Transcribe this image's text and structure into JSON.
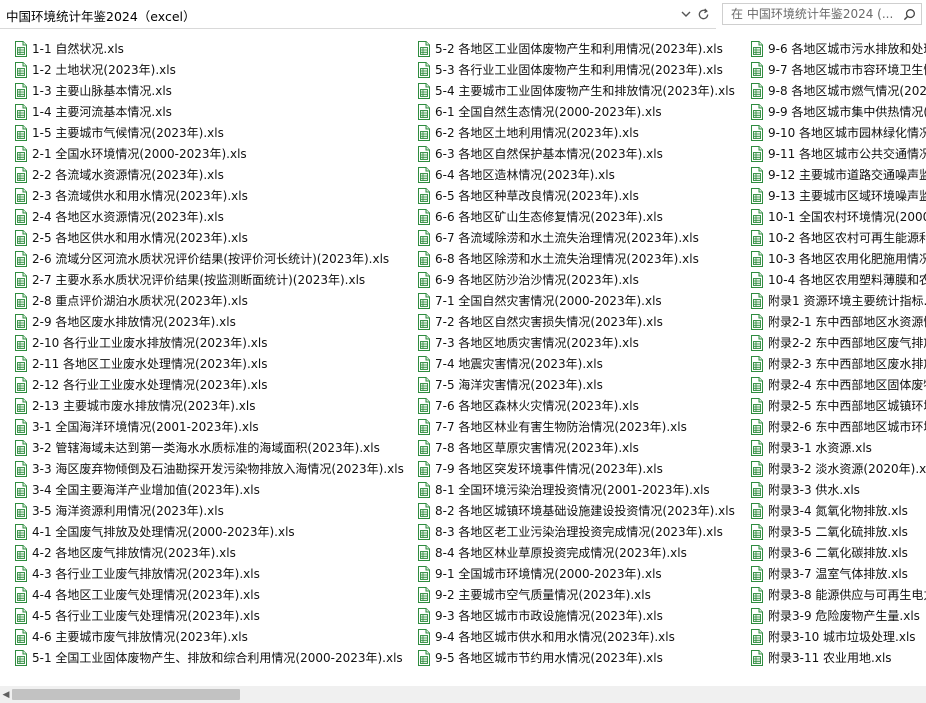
{
  "address_bar": {
    "path": "中国环境统计年鉴2024（excel）"
  },
  "search": {
    "placeholder": "在 中国环境统计年鉴2024 (... "
  },
  "columns": [
    [
      "1-1 自然状况.xls",
      "1-2 土地状况(2023年).xls",
      "1-3 主要山脉基本情况.xls",
      "1-4 主要河流基本情况.xls",
      "1-5 主要城市气候情况(2023年).xls",
      "2-1 全国水环境情况(2000-2023年).xls",
      "2-2 各流域水资源情况(2023年).xls",
      "2-3 各流域供水和用水情况(2023年).xls",
      "2-4 各地区水资源情况(2023年).xls",
      "2-5 各地区供水和用水情况(2023年).xls",
      "2-6 流域分区河流水质状况评价结果(按评价河长统计)(2023年).xls",
      "2-7 主要水系水质状况评价结果(按监测断面统计)(2023年).xls",
      "2-8 重点评价湖泊水质状况(2023年).xls",
      "2-9 各地区废水排放情况(2023年).xls",
      "2-10 各行业工业废水排放情况(2023年).xls",
      "2-11 各地区工业废水处理情况(2023年).xls",
      "2-12 各行业工业废水处理情况(2023年).xls",
      "2-13 主要城市废水排放情况(2023年).xls",
      "3-1 全国海洋环境情况(2001-2023年).xls",
      "3-2 管辖海域未达到第一类海水水质标准的海域面积(2023年).xls",
      "3-3 海区废弃物倾倒及石油勘探开发污染物排放入海情况(2023年).xls",
      "3-4 全国主要海洋产业增加值(2023年).xls",
      "3-5 海洋资源利用情况(2023年).xls",
      "4-1 全国废气排放及处理情况(2000-2023年).xls",
      "4-2 各地区废气排放情况(2023年).xls",
      "4-3 各行业工业废气排放情况(2023年).xls",
      "4-4 各地区工业废气处理情况(2023年).xls",
      "4-5 各行业工业废气处理情况(2023年).xls",
      "4-6 主要城市废气排放情况(2023年).xls",
      "5-1 全国工业固体废物产生、排放和综合利用情况(2000-2023年).xls"
    ],
    [
      "5-2 各地区工业固体废物产生和利用情况(2023年).xls",
      "5-3 各行业工业固体废物产生和利用情况(2023年).xls",
      "5-4 主要城市工业固体废物产生和排放情况(2023年).xls",
      "6-1 全国自然生态情况(2000-2023年).xls",
      "6-2 各地区土地利用情况(2023年).xls",
      "6-3 各地区自然保护基本情况(2023年).xls",
      "6-4 各地区造林情况(2023年).xls",
      "6-5 各地区种草改良情况(2023年).xls",
      "6-6 各地区矿山生态修复情况(2023年).xls",
      "6-7 各流域除涝和水土流失治理情况(2023年).xls",
      "6-8 各地区除涝和水土流失治理情况(2023年).xls",
      "6-9 各地区防沙治沙情况(2023年).xls",
      "7-1 全国自然灾害情况(2000-2023年).xls",
      "7-2 各地区自然灾害损失情况(2023年).xls",
      "7-3 各地区地质灾害情况(2023年).xls",
      "7-4 地震灾害情况(2023年).xls",
      "7-5 海洋灾害情况(2023年).xls",
      "7-6 各地区森林火灾情况(2023年).xls",
      "7-7 各地区林业有害生物防治情况(2023年).xls",
      "7-8 各地区草原灾害情况(2023年).xls",
      "7-9 各地区突发环境事件情况(2023年).xls",
      "8-1 全国环境污染治理投资情况(2001-2023年).xls",
      "8-2 各地区城镇环境基础设施建设投资情况(2023年).xls",
      "8-3 各地区老工业污染治理投资完成情况(2023年).xls",
      "8-4 各地区林业草原投资完成情况(2023年).xls",
      "9-1 全国城市环境情况(2000-2023年).xls",
      "9-2 主要城市空气质量情况(2023年).xls",
      "9-3 各地区城市市政设施情况(2023年).xls",
      "9-4 各地区城市供水和用水情况(2023年).xls",
      "9-5 各地区城市节约用水情况(2023年).xls"
    ],
    [
      "9-6 各地区城市污水排放和处理",
      "9-7 各地区城市市容环境卫生情",
      "9-8 各地区城市燃气情况(2023",
      "9-9 各地区城市集中供热情况(",
      "9-10 各地区城市园林绿化情况",
      "9-11 各地区城市公共交通情况",
      "9-12 主要城市道路交通噪声监",
      "9-13 主要城市区域环境噪声监",
      "10-1 全国农村环境情况(2000-",
      "10-2 各地区农村可再生能源利",
      "10-3 各地区农用化肥施用情况",
      "10-4 各地区农用塑料薄膜和农",
      "附录1 资源环境主要统计指标.x",
      "附录2-1 东中西部地区水资源情",
      "附录2-2 东中西部地区废气排放",
      "附录2-3 东中西部地区废水排放",
      "附录2-4 东中西部地区固体废物",
      "附录2-5 东中西部地区城镇环境",
      "附录2-6 东中西部地区城市环境",
      "附录3-1 水资源.xls",
      "附录3-2 淡水资源(2020年).xls",
      "附录3-3 供水.xls",
      "附录3-4 氮氧化物排放.xls",
      "附录3-5 二氧化硫排放.xls",
      "附录3-6 二氧化碳排放.xls",
      "附录3-7 温室气体排放.xls",
      "附录3-8 能源供应与可再生电力",
      "附录3-9 危险废物产生量.xls",
      "附录3-10 城市垃圾处理.xls",
      "附录3-11 农业用地.xls"
    ]
  ],
  "icons": {
    "file": "excel-file-icon",
    "dropdown": "chevron-down-icon",
    "refresh": "refresh-icon",
    "search": "search-icon"
  },
  "colors": {
    "excel_green": "#2e8b3e",
    "excel_light": "#e4f2e6"
  }
}
